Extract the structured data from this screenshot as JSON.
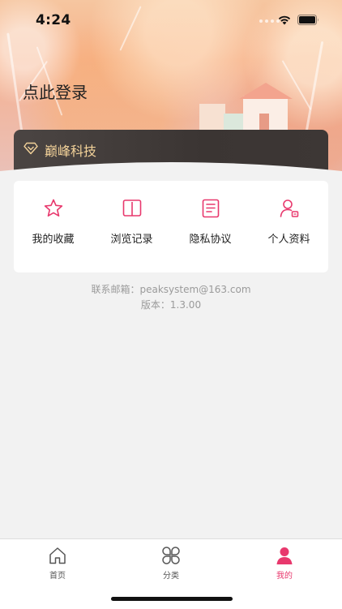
{
  "status_bar": {
    "time": "4:24"
  },
  "header": {
    "login_text": "点此登录"
  },
  "vip_banner": {
    "label": "巅峰科技",
    "icon": "diamond-icon"
  },
  "menu": {
    "items": [
      {
        "label": "我的收藏",
        "icon": "star-icon"
      },
      {
        "label": "浏览记录",
        "icon": "book-icon"
      },
      {
        "label": "隐私协议",
        "icon": "document-icon"
      },
      {
        "label": "个人资料",
        "icon": "user-card-icon"
      }
    ]
  },
  "contact": {
    "email_line": "联系邮箱：peaksystem@163.com",
    "version_line": "版本：1.3.00"
  },
  "tab_bar": {
    "tabs": [
      {
        "label": "首页",
        "icon": "home-icon",
        "active": false
      },
      {
        "label": "分类",
        "icon": "category-icon",
        "active": false
      },
      {
        "label": "我的",
        "icon": "profile-icon",
        "active": true
      }
    ]
  },
  "colors": {
    "accent": "#e8386d",
    "vip_text": "#f4d39a",
    "vip_bg": "#3d3735",
    "page_bg": "#f2f2f2"
  }
}
